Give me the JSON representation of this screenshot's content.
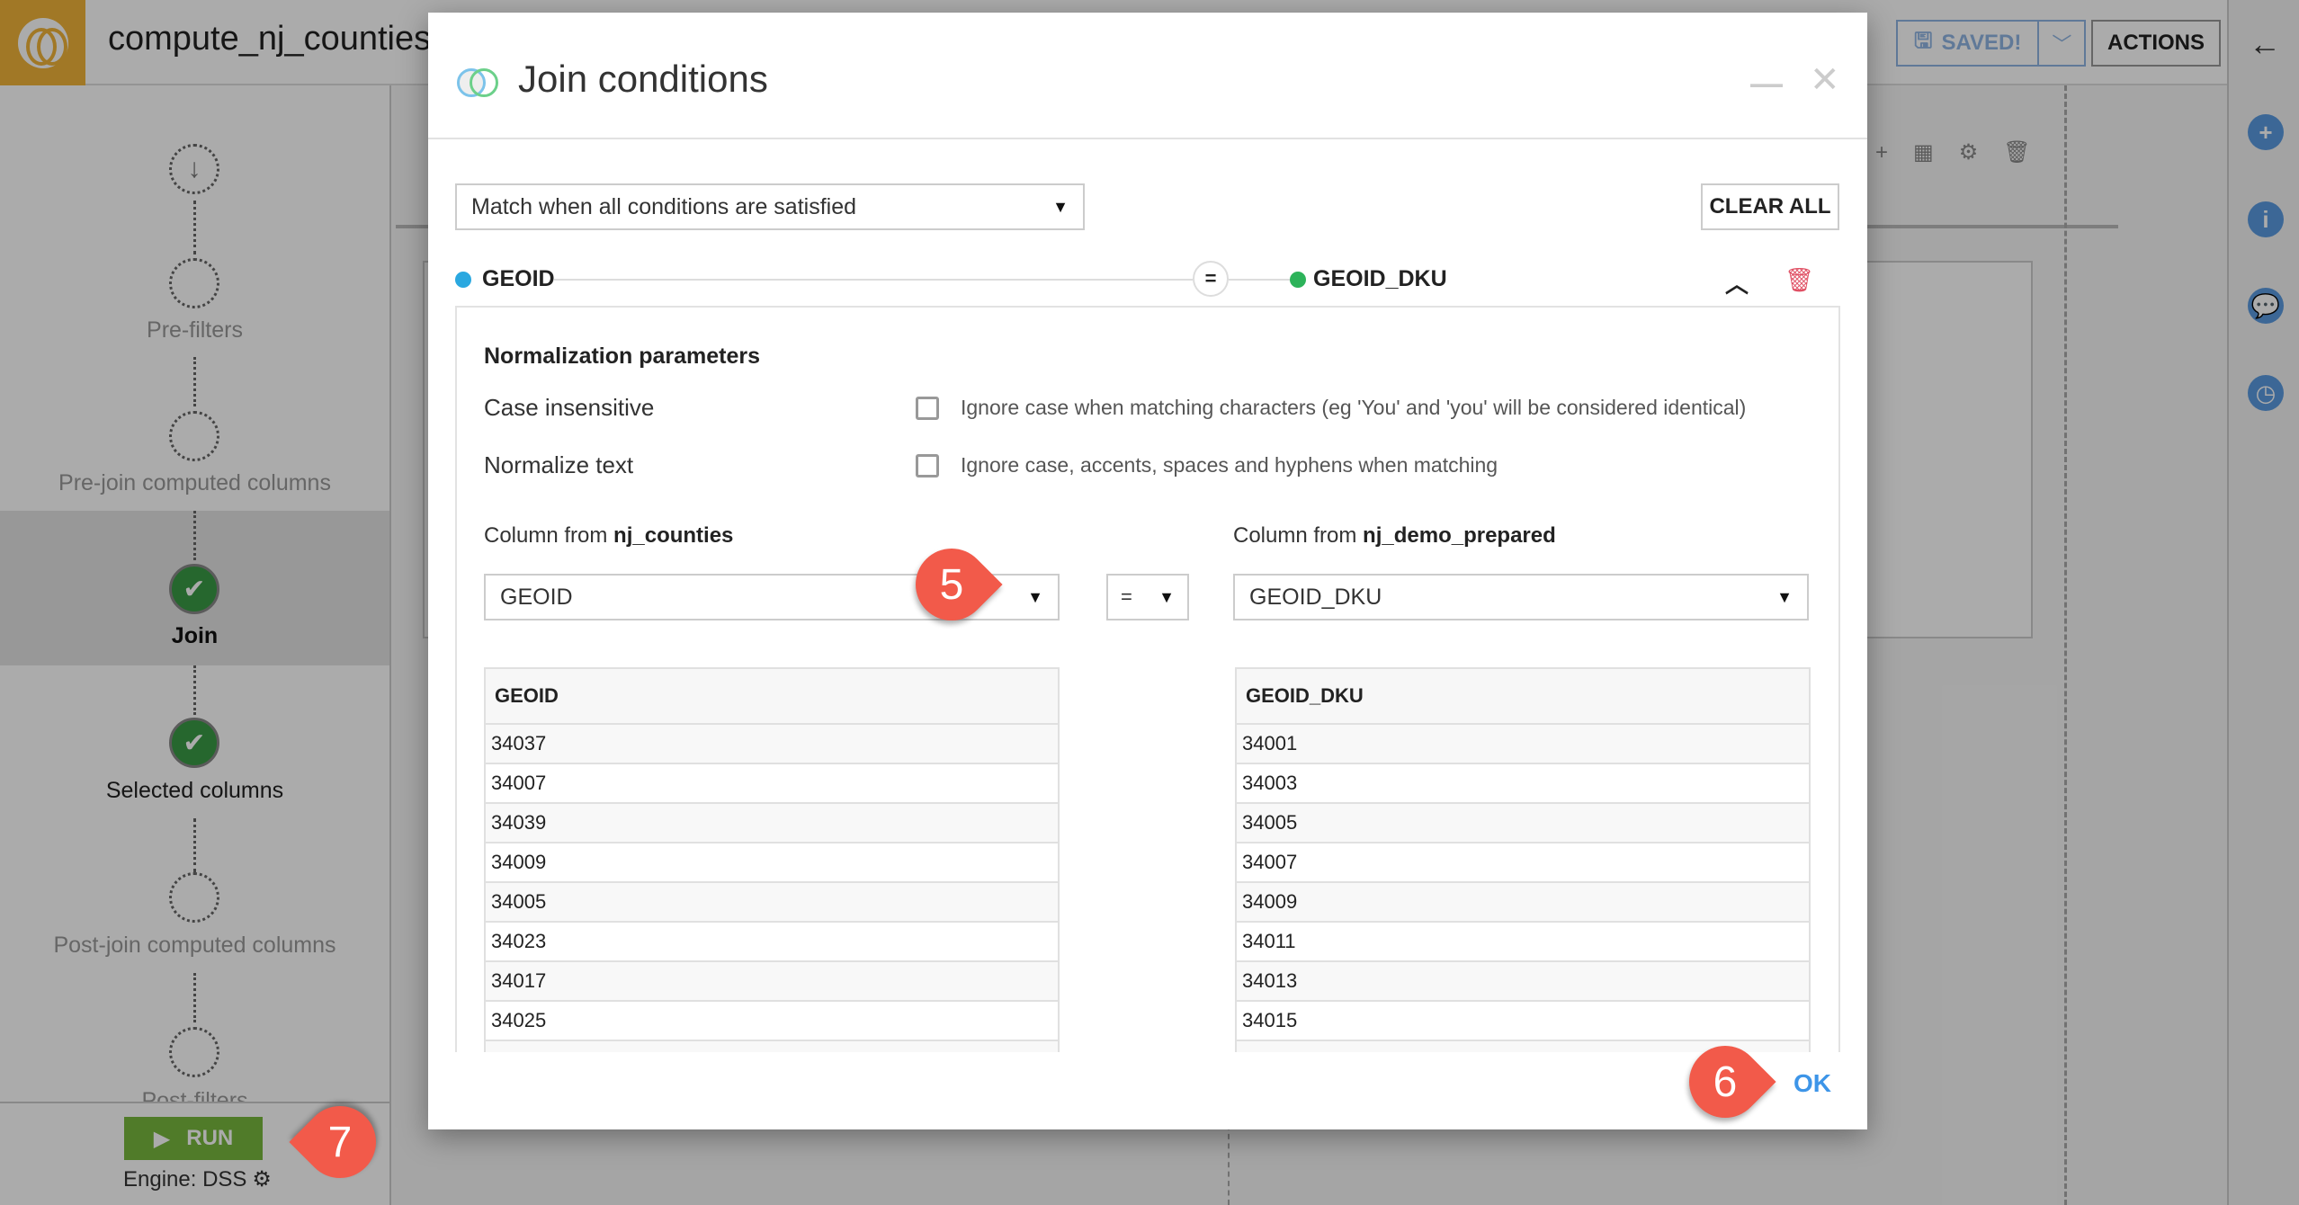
{
  "app": {
    "recipe_title": "compute_nj_counties_",
    "saved_label": "SAVED!",
    "actions_label": "ACTIONS",
    "back_icon": "arrow-left-icon",
    "rail_icons": [
      "plus-icon",
      "info-icon",
      "discussions-icon",
      "history-icon"
    ]
  },
  "steps": [
    {
      "label": "",
      "state": "input",
      "icon": "↓"
    },
    {
      "label": "Pre-filters",
      "state": "empty"
    },
    {
      "label": "Pre-join computed columns",
      "state": "empty"
    },
    {
      "label": "Join",
      "state": "done",
      "selected": true
    },
    {
      "label": "Selected columns",
      "state": "done"
    },
    {
      "label": "Post-join computed columns",
      "state": "empty"
    },
    {
      "label": "Post-filters",
      "state": "empty"
    }
  ],
  "run": {
    "label": "RUN",
    "engine": "Engine: DSS"
  },
  "modal": {
    "title": "Join conditions",
    "match_mode": "Match when all conditions are satisfied",
    "clear_all": "CLEAR ALL",
    "condition": {
      "left_column": "GEOID",
      "operator": "=",
      "right_column": "GEOID_DKU",
      "left_color": "#2aa8e0",
      "right_color": "#2db35a"
    },
    "normalization": {
      "title": "Normalization parameters",
      "options": [
        {
          "label": "Case insensitive",
          "description": "Ignore case when matching characters (eg 'You' and 'you' will be considered identical)",
          "checked": false
        },
        {
          "label": "Normalize text",
          "description": "Ignore case, accents, spaces and hyphens when matching",
          "checked": false
        }
      ]
    },
    "left": {
      "prefix": "Column from ",
      "dataset": "nj_counties",
      "selected": "GEOID",
      "header": "GEOID",
      "values": [
        "34037",
        "34007",
        "34039",
        "34009",
        "34005",
        "34023",
        "34017",
        "34025"
      ]
    },
    "operator_select": "=",
    "right": {
      "prefix": "Column from ",
      "dataset": "nj_demo_prepared",
      "selected": "GEOID_DKU",
      "header": "GEOID_DKU",
      "values": [
        "34001",
        "34003",
        "34005",
        "34007",
        "34009",
        "34011",
        "34013",
        "34015"
      ]
    },
    "ok_label": "OK"
  },
  "callouts": [
    "5",
    "6",
    "7"
  ]
}
